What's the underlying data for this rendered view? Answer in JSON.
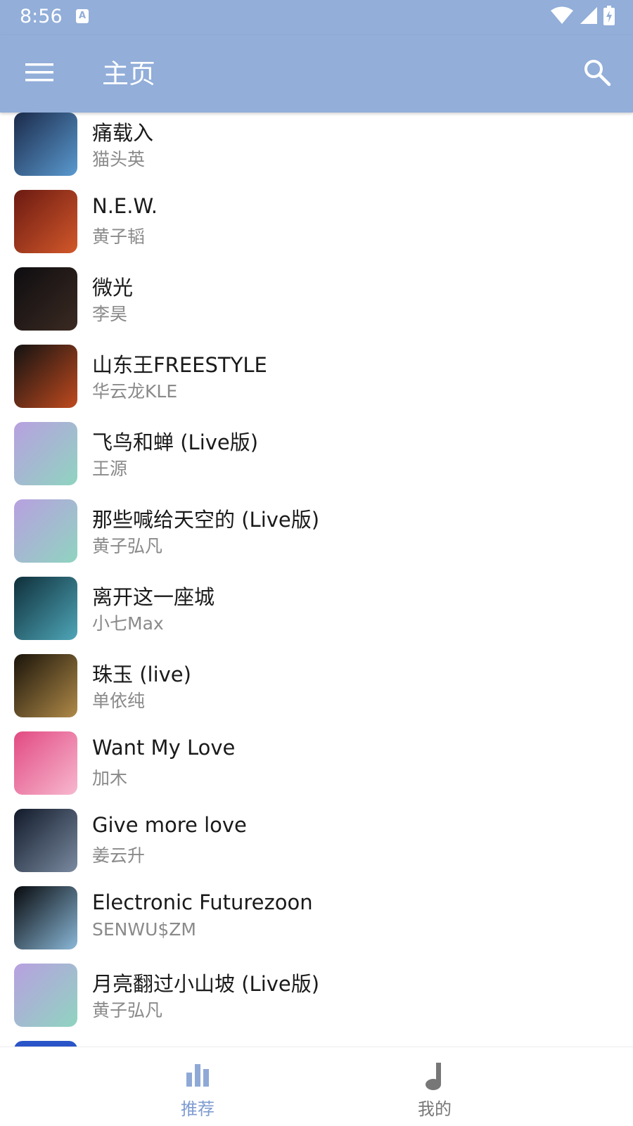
{
  "status_bar": {
    "time": "8:56",
    "notification_icon": "A"
  },
  "app_bar": {
    "title": "主页"
  },
  "songs": [
    {
      "title": "痛载入",
      "artist": "猫头英",
      "art_colors": [
        "#1b2a4a",
        "#5a9ad0"
      ]
    },
    {
      "title": "N.E.W.",
      "artist": "黄子韬",
      "art_colors": [
        "#6b1a12",
        "#d2582a"
      ]
    },
    {
      "title": "微光",
      "artist": "李昊",
      "art_colors": [
        "#0e0d10",
        "#3b2a22"
      ]
    },
    {
      "title": "山东王FREESTYLE",
      "artist": "华云龙KLE",
      "art_colors": [
        "#121212",
        "#c04a1e"
      ]
    },
    {
      "title": "飞鸟和蝉 (Live版)",
      "artist": "王源",
      "art_colors": [
        "#b8a0e0",
        "#8fd4c0"
      ]
    },
    {
      "title": "那些喊给天空的 (Live版)",
      "artist": "黄子弘凡",
      "art_colors": [
        "#b8a0e0",
        "#8fd4c0"
      ]
    },
    {
      "title": "离开这一座城",
      "artist": "小七Max",
      "art_colors": [
        "#0f2f3a",
        "#4ea6b8"
      ]
    },
    {
      "title": "珠玉 (live)",
      "artist": "单依纯",
      "art_colors": [
        "#1a140a",
        "#b08a48"
      ]
    },
    {
      "title": "Want My Love",
      "artist": "加木",
      "art_colors": [
        "#e24a82",
        "#f7b8cf"
      ]
    },
    {
      "title": "Give more love",
      "artist": "姜云升",
      "art_colors": [
        "#111a2a",
        "#7a8aa0"
      ]
    },
    {
      "title": "Electronic Futurezoon",
      "artist": "SENWU$ZM",
      "art_colors": [
        "#07090c",
        "#8ab8d8"
      ]
    },
    {
      "title": "月亮翻过小山坡 (Live版)",
      "artist": "黄子弘凡",
      "art_colors": [
        "#b8a0e0",
        "#8fd4c0"
      ]
    },
    {
      "title": "",
      "artist": "",
      "art_colors": [
        "#2a55c8",
        "#2a55c8"
      ]
    }
  ],
  "bottom_nav": {
    "tabs": [
      {
        "label": "推荐",
        "icon": "bar-chart-icon",
        "active": true
      },
      {
        "label": "我的",
        "icon": "music-note-icon",
        "active": false
      }
    ]
  },
  "colors": {
    "primary": "#92aed9",
    "accent": "#7e9bd0",
    "inactive": "#777777"
  }
}
